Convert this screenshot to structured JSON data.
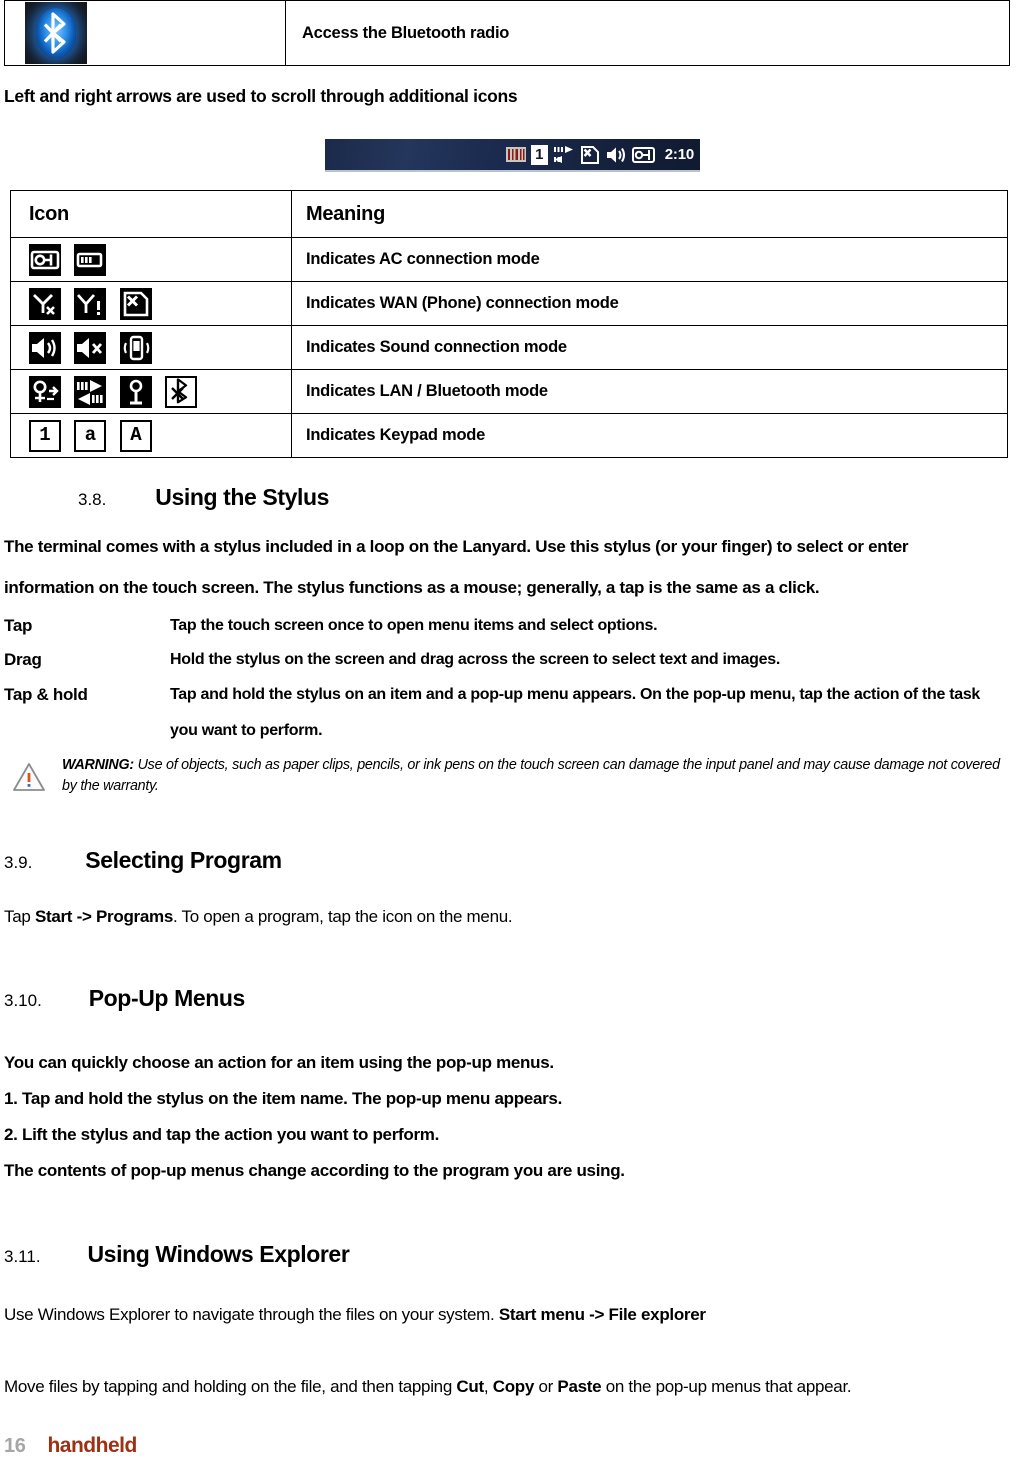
{
  "bluetooth_row": {
    "icon_name": "bluetooth-radio-icon",
    "meaning": "Access the Bluetooth radio"
  },
  "intro_line": "Left and right arrows are used to scroll through additional icons",
  "taskbar": {
    "time": "2:10",
    "boxed_label": "1",
    "icons": [
      "barcode-icon",
      "keypad-numeric-icon",
      "network-transfer-icon",
      "sim-card-error-icon",
      "speaker-icon",
      "ac-power-plug-icon"
    ]
  },
  "icon_table": {
    "headers": [
      "Icon",
      "Meaning"
    ],
    "rows": [
      {
        "icons": [
          "ac-power-plug-icon",
          "battery-icon"
        ],
        "meaning": "Indicates AC connection mode"
      },
      {
        "icons": [
          "antenna-no-signal-icon",
          "antenna-alert-icon",
          "sim-card-error-icon"
        ],
        "meaning": "Indicates WAN (Phone) connection mode"
      },
      {
        "icons": [
          "speaker-on-icon",
          "speaker-mute-icon",
          "vibrate-icon"
        ],
        "meaning": "Indicates Sound connection mode"
      },
      {
        "icons": [
          "wireless-connect-icon",
          "network-arrows-icon",
          "antenna-signal-icon",
          "bluetooth-icon"
        ],
        "meaning": "Indicates LAN / Bluetooth mode"
      },
      {
        "icons": [
          "keypad-numeric-icon",
          "keypad-lowercase-icon",
          "keypad-uppercase-icon"
        ],
        "meaning": "Indicates Keypad mode"
      }
    ],
    "keypad_chars": [
      "1",
      "a",
      "A"
    ]
  },
  "sections": {
    "stylus": {
      "number": "3.8.",
      "title": "Using the Stylus",
      "paragraph_line1": "The terminal comes with a stylus included in a loop on the Lanyard. Use this stylus (or your finger) to select or enter",
      "paragraph_line2": "information on the touch screen. The stylus functions as a mouse; generally, a tap is the same as a click.",
      "terms": [
        {
          "term": "Tap",
          "definition": "Tap the touch screen once to open menu items and select options."
        },
        {
          "term": "Drag",
          "definition": "Hold the stylus on the screen and drag across the screen to select text and images."
        },
        {
          "term": "Tap & hold",
          "definition": "Tap and hold the stylus on an item and a pop-up menu appears. On the pop-up menu, tap the action of the task"
        },
        {
          "term": "",
          "definition": "you want to perform."
        }
      ],
      "warning": {
        "label": "WARNING:",
        "text": "Use of objects, such as paper clips, pencils, or ink pens on the touch screen can damage the input panel and may cause damage not covered by the warranty."
      }
    },
    "selecting_program": {
      "number": "3.9.",
      "title": "Selecting Program",
      "body_prefix": "Tap ",
      "body_bold": "Start -> Programs",
      "body_suffix": ". To open a program, tap the icon on the menu."
    },
    "popup_menus": {
      "number": "3.10.",
      "title": "Pop-Up Menus",
      "lines": [
        "You can quickly choose an action for an item using the pop-up menus.",
        "1. Tap and hold the stylus on the item name. The pop-up menu appears.",
        "2. Lift the stylus and tap the action you want to perform.",
        "The contents of pop-up menus change according to the program you are using."
      ]
    },
    "windows_explorer": {
      "number": "3.11.",
      "title": "Using Windows Explorer",
      "line1_prefix": "Use Windows Explorer to navigate through the files on your system. ",
      "line1_bold": "Start menu -> File explorer",
      "line2_prefix": "Move files by tapping and holding on the file, and then tapping ",
      "line2_bold1": "Cut",
      "line2_mid1": ", ",
      "line2_bold2": "Copy",
      "line2_mid2": " or ",
      "line2_bold3": "Paste",
      "line2_suffix": " on the pop-up menus that appear."
    }
  },
  "footer": {
    "page_number": "16",
    "brand": "handheld",
    "page_color": "#a6a6a6",
    "brand_color": "#9e3113"
  }
}
